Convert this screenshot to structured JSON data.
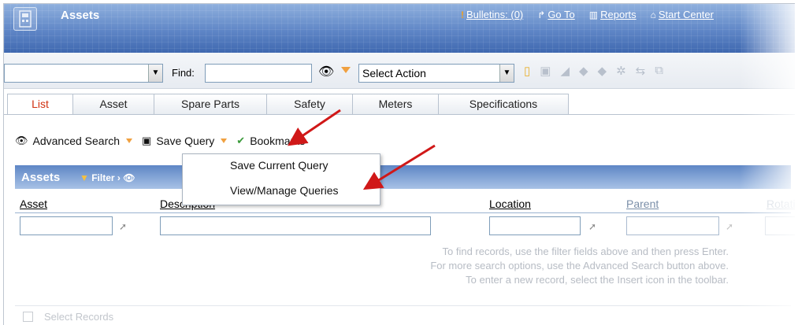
{
  "window": {
    "title": "Assets"
  },
  "topnav": {
    "bulletins": "Bulletins: (0)",
    "goto": "Go To",
    "reports": "Reports",
    "start_center": "Start Center"
  },
  "toolbar": {
    "find_label": "Find:",
    "find_value": "",
    "query_value": "",
    "select_action": "Select Action"
  },
  "tabs": [
    {
      "label": "List"
    },
    {
      "label": "Asset"
    },
    {
      "label": "Spare Parts"
    },
    {
      "label": "Safety"
    },
    {
      "label": "Meters"
    },
    {
      "label": "Specifications"
    }
  ],
  "actions": {
    "advanced_search": "Advanced Search",
    "save_query": "Save Query",
    "bookmarks": "Bookmarks"
  },
  "menu": {
    "items": [
      {
        "label": "Save Current Query"
      },
      {
        "label": "View/Manage Queries"
      }
    ]
  },
  "section": {
    "title": "Assets",
    "filter": "Filter"
  },
  "columns": [
    {
      "label": "Asset"
    },
    {
      "label": "Description"
    },
    {
      "label": "Location"
    },
    {
      "label": "Parent"
    },
    {
      "label": "Rotating"
    }
  ],
  "messages": [
    "To find records, use the filter fields above and then press Enter.",
    "For more search options, use the Advanced Search button above.",
    "To enter a new record, select the Insert icon in the toolbar."
  ],
  "select_records": "Select Records",
  "colors": {
    "active_tab": "#d03010",
    "annotation_arrow": "#d01818",
    "header_blue": "#5f86c6"
  }
}
